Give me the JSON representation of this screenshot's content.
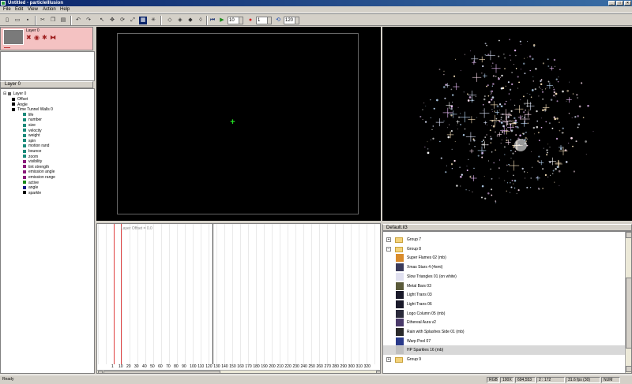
{
  "window": {
    "title": "Untitled - particleIllusion"
  },
  "menu": [
    "File",
    "Edit",
    "View",
    "Action",
    "Help"
  ],
  "toolbar": {
    "frame_field": "10",
    "record_field": "1",
    "fps_field": "120",
    "icons": [
      "new-icon",
      "open-icon",
      "save-icon",
      "cut-icon",
      "copy-icon",
      "paste-icon",
      "undo-icon",
      "redo-icon",
      "rewind-icon",
      "play-icon",
      "record-icon",
      "loop-icon"
    ]
  },
  "layer": {
    "name": "Layer 0",
    "header": "Layer 0"
  },
  "tree": {
    "root": "Layer 0",
    "items": [
      {
        "label": "Offset",
        "color": "#000000",
        "level": 1
      },
      {
        "label": "Angle",
        "color": "#000000",
        "level": 1
      },
      {
        "label": "Time Tunnel Walls 0",
        "color": "#000000",
        "level": 1
      },
      {
        "label": "life",
        "color": "#1a8a7a",
        "level": 2
      },
      {
        "label": "number",
        "color": "#1a8a7a",
        "level": 2
      },
      {
        "label": "size",
        "color": "#1a8a7a",
        "level": 2
      },
      {
        "label": "velocity",
        "color": "#1a8a7a",
        "level": 2
      },
      {
        "label": "weight",
        "color": "#1a8a7a",
        "level": 2
      },
      {
        "label": "spin",
        "color": "#1a8a7a",
        "level": 2
      },
      {
        "label": "motion rand",
        "color": "#1a8a7a",
        "level": 2
      },
      {
        "label": "bounce",
        "color": "#1a8a7a",
        "level": 2
      },
      {
        "label": "zoom",
        "color": "#1a8a7a",
        "level": 2
      },
      {
        "label": "visibility",
        "color": "#8a1a7a",
        "level": 2
      },
      {
        "label": "tint strength",
        "color": "#8a1a7a",
        "level": 2
      },
      {
        "label": "emission angle",
        "color": "#8a1a7a",
        "level": 2
      },
      {
        "label": "emission range",
        "color": "#8a1a7a",
        "level": 2
      },
      {
        "label": "active",
        "color": "#1a8a1a",
        "level": 2
      },
      {
        "label": "angle",
        "color": "#1a1a8a",
        "level": 2
      },
      {
        "label": "sparkle",
        "color": "#000000",
        "level": 2
      }
    ]
  },
  "timeline": {
    "label": "Layer Offset = 0.0",
    "ticks": [
      "1",
      "10",
      "20",
      "30",
      "40",
      "50",
      "60",
      "70",
      "80",
      "90",
      "100",
      "110",
      "120",
      "130",
      "140",
      "150",
      "160",
      "170",
      "180",
      "190",
      "200",
      "210",
      "220",
      "230",
      "240",
      "250",
      "260",
      "270",
      "280",
      "290",
      "300",
      "310",
      "320"
    ]
  },
  "library": {
    "header": "Default.il3",
    "rows": [
      {
        "name": "Group 7",
        "type": "group",
        "expanded": false
      },
      {
        "name": "Group 8",
        "type": "group",
        "expanded": true
      },
      {
        "name": "Super Flames 02 (mb)",
        "type": "emitter",
        "color": "#d98b2b"
      },
      {
        "name": "Xmas Stars 4 (4xmi)",
        "type": "emitter",
        "color": "#3a3a5a"
      },
      {
        "name": "Slow Triangles 01 (on white)",
        "type": "emitter",
        "color": "#e0e0f0"
      },
      {
        "name": "Metal Bars 03",
        "type": "emitter",
        "color": "#5a5a3a"
      },
      {
        "name": "Light Trans 03",
        "type": "emitter",
        "color": "#1a1a2a"
      },
      {
        "name": "Light Trans 06",
        "type": "emitter",
        "color": "#1a1a2a"
      },
      {
        "name": "Logo Column 05 (mb)",
        "type": "emitter",
        "color": "#2a2a3a"
      },
      {
        "name": "Ethereal  Aura v2",
        "type": "emitter",
        "color": "#4a3a6a"
      },
      {
        "name": "Rain with Splashes Side 01 (mb)",
        "type": "emitter",
        "color": "#2a2a2a"
      },
      {
        "name": "Warp Pool 07",
        "type": "emitter",
        "color": "#2a3a8a"
      },
      {
        "name": "HP Sparkles 16 (mb)",
        "type": "emitter",
        "color": "#c0c0c0",
        "selected": true
      },
      {
        "name": "Group 9",
        "type": "group",
        "expanded": false
      }
    ]
  },
  "status": {
    "ready": "Ready",
    "mode": "RGB",
    "zoom": "100X",
    "coords": "694,553",
    "frame": "2 : 172",
    "fps": "31.6 fps (30)",
    "num": "NUM"
  },
  "colors": {
    "layer_bg": "#f4c2c2",
    "playhead": "#e04040",
    "emitter_marker": "#22dd22",
    "titlebar": "#0a246a"
  }
}
